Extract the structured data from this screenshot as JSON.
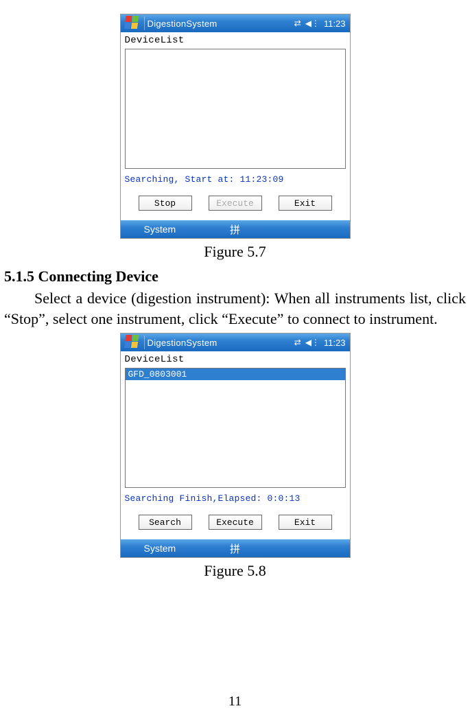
{
  "screens": {
    "s1": {
      "titlebar": {
        "title": "DigestionSystem",
        "time": "11:23"
      },
      "label": "DeviceList",
      "status": "Searching, Start at: 11:23:09",
      "buttons": {
        "left": "Stop",
        "mid": "Execute",
        "right": "Exit"
      },
      "bottombar": {
        "left": "System",
        "center": "拼"
      }
    },
    "s2": {
      "titlebar": {
        "title": "DigestionSystem",
        "time": "11:23"
      },
      "label": "DeviceList",
      "item": "GFD_0803001",
      "status": "Searching Finish,Elapsed: 0:0:13",
      "buttons": {
        "left": "Search",
        "mid": "Execute",
        "right": "Exit"
      },
      "bottombar": {
        "left": "System",
        "center": "拼"
      }
    }
  },
  "captions": {
    "fig1": "Figure 5.7",
    "fig2": "Figure 5.8"
  },
  "text": {
    "heading": "5.1.5 Connecting Device",
    "paragraph": "Select a device (digestion instrument): When all instruments list, click “Stop”, select one instrument, click “Execute” to connect to instrument."
  },
  "page_number": "11"
}
